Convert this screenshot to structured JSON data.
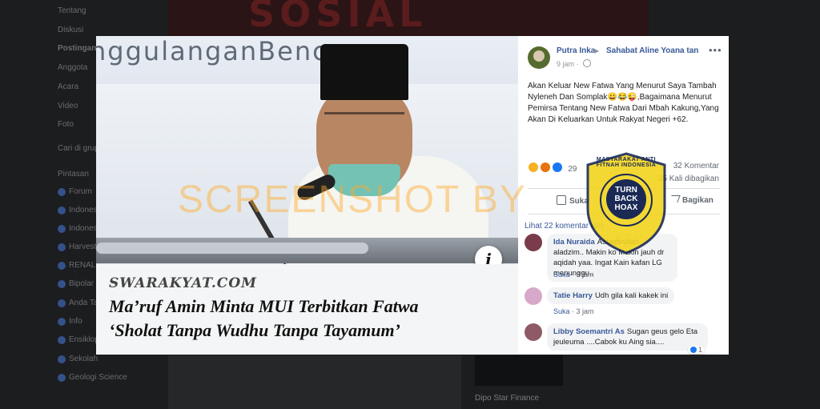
{
  "background": {
    "sidebar_items": [
      "Tentang",
      "Diskusi",
      "Postingan",
      "Anggota",
      "Acara",
      "Video",
      "Foto",
      "Cari di grup ini",
      "Pintasan",
      "Forum",
      "Indonesia",
      "Indonesia",
      "Harvest",
      "RENAL",
      "Bipolar",
      "Anda Tahu",
      "Info",
      "Ensiklopedia",
      "Sekolah",
      "Geologi Science"
    ],
    "ad_label": "Dipo Star Finance"
  },
  "photo": {
    "backdrop_text": "nggulanganBencanaa",
    "source": "SWARAKYAT.COM",
    "headline_line1": "Ma’ruf Amin Minta MUI Terbitkan Fatwa",
    "headline_line2": "‘Sholat Tanpa Wudhu Tanpa Tayamum’",
    "info_glyph": "i"
  },
  "post": {
    "author": "Putra Inka",
    "group": "Sahabat Aline Yoana tan",
    "time": "9 jam",
    "more": "•••",
    "text": "Akan Keluar New Fatwa Yang Menurut Saya Tambah Nyleneh Dan Somplak😀😂😜,Bagaimana Menurut Pemirsa Tentang New Fatwa Dari Mbah Kakung,Yang Akan Di Keluarkan Untuk Rakyat Negeri +62.",
    "reaction_count": "29",
    "comment_count": "32 Komentar",
    "share_count": "35 Kali dibagikan",
    "like_label": "Suka",
    "share_label": "Bagikan",
    "see_more": "Lihat 22 komentar lain"
  },
  "comments": [
    {
      "name": "Ida Nuraida",
      "text": "Astagfirullah aladzim.. Makin ko Makin jauh dr aqidah yaa. Ingat Kain kafan LG menunggu..",
      "like": "Suka",
      "time": "3 jam"
    },
    {
      "name": "Tatie Harry",
      "text": "Udh gila kali kakek ini",
      "like": "Suka",
      "time": "3 jam"
    },
    {
      "name": "Libby Soemantri As",
      "text": "Sugan geus gelo Eta jeuleuma ....Cabok ku Aing sia....",
      "reacts": "1"
    }
  ],
  "watermark": {
    "text": "SCREENSHOT BY",
    "badge_center": "TURN BACK HOAX",
    "badge_ring": "MASYARAKAT ANTI FITNAH INDONESIA"
  },
  "colors": {
    "link": "#385898",
    "watermark": "#ffaa28",
    "badge_navy": "#1a2a55"
  }
}
